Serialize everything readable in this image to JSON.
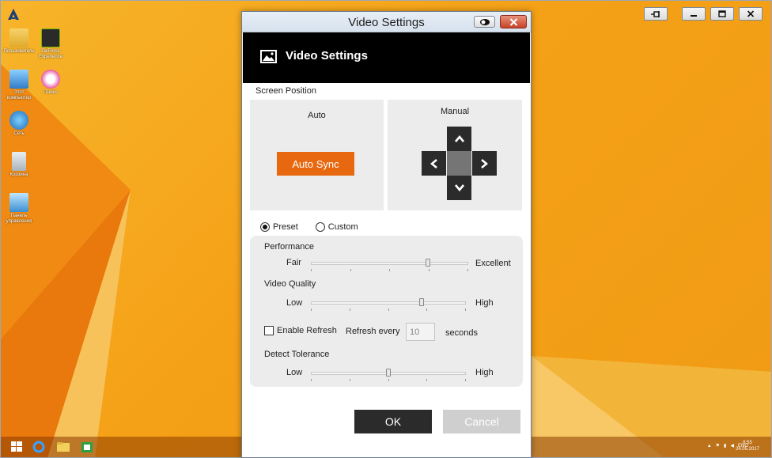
{
  "window": {
    "title": "Video Settings"
  },
  "header": {
    "title": "Video Settings",
    "icon": "image-icon"
  },
  "screen_position": {
    "label": "Screen Position",
    "auto": {
      "caption": "Auto",
      "button_label": "Auto Sync"
    },
    "manual": {
      "caption": "Manual"
    }
  },
  "mode": {
    "preset_label": "Preset",
    "custom_label": "Custom",
    "selected": "Preset"
  },
  "performance": {
    "label": "Performance",
    "min_label": "Fair",
    "max_label": "Excellent",
    "value_fraction": 0.75
  },
  "video_quality": {
    "label": "Video Quality",
    "min_label": "Low",
    "max_label": "High",
    "value_fraction": 0.72
  },
  "refresh": {
    "checkbox_label": "Enable Refresh",
    "checked": false,
    "prefix": "Refresh every",
    "value": "10",
    "suffix": "seconds"
  },
  "detect_tolerance": {
    "label": "Detect Tolerance",
    "min_label": "Low",
    "max_label": "High",
    "value_fraction": 0.5
  },
  "buttons": {
    "ok": "OK",
    "cancel": "Cancel"
  },
  "desktop": {
    "icons": [
      {
        "name": "Пользователь",
        "icon": "user-folder-icon"
      },
      {
        "name": "GeForce Experience",
        "icon": "nvidia-icon"
      },
      {
        "name": "Этот компьютер",
        "icon": "computer-icon"
      },
      {
        "name": "iTunes",
        "icon": "itunes-icon"
      },
      {
        "name": "Сеть",
        "icon": "network-icon"
      },
      {
        "name": "Корзина",
        "icon": "recycle-bin-icon"
      },
      {
        "name": "Панель управления",
        "icon": "control-panel-icon"
      }
    ]
  },
  "taskbar": {
    "language": "ENG",
    "time": "8:55",
    "date": "24.05.2017"
  },
  "colors": {
    "accent": "#e8680f",
    "dark": "#2b2b2b",
    "desktop_bg": "#f6a21b"
  }
}
